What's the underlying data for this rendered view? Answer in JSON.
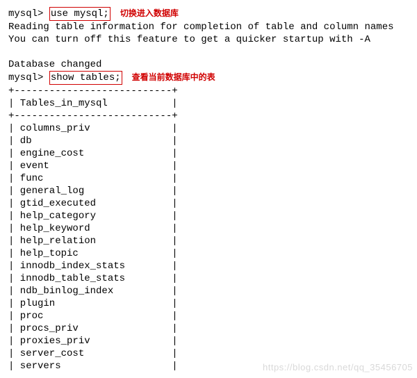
{
  "prompt": "mysql> ",
  "cmd1": "use mysql;",
  "anno1": "切换进入数据库",
  "reading1": "Reading table information for completion of table and column names",
  "reading2": "You can turn off this feature to get a quicker startup with -A",
  "db_changed": "Database changed",
  "cmd2": "show tables;",
  "anno2": "查看当前数据库中的表",
  "divider": "+---------------------------+",
  "col_header": "| Tables_in_mysql           |",
  "tables": [
    "columns_priv",
    "db",
    "engine_cost",
    "event",
    "func",
    "general_log",
    "gtid_executed",
    "help_category",
    "help_keyword",
    "help_relation",
    "help_topic",
    "innodb_index_stats",
    "innodb_table_stats",
    "ndb_binlog_index",
    "plugin",
    "proc",
    "procs_priv",
    "proxies_priv",
    "server_cost",
    "servers"
  ],
  "watermark": "https://blog.csdn.net/qq_35456705"
}
